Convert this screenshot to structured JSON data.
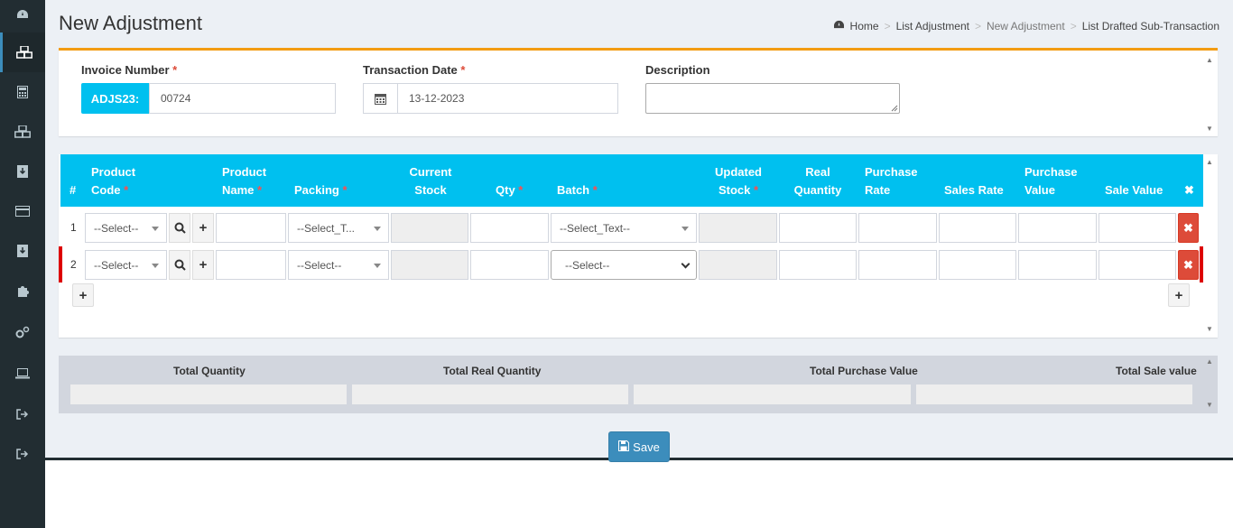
{
  "header": {
    "title": "New Adjustment",
    "breadcrumb": [
      "Home",
      "List Adjustment",
      "New Adjustment",
      "List Drafted Sub-Transaction"
    ],
    "separator": ">"
  },
  "sidebar": {
    "icons": [
      "dashboard-icon",
      "cubes-icon",
      "calculator-icon",
      "cubes-icon",
      "download-icon",
      "credit-card-icon",
      "download-icon",
      "puzzle-icon",
      "gears-icon",
      "laptop-icon",
      "sign-out-icon",
      "sign-out-icon"
    ]
  },
  "form": {
    "invoice_label": "Invoice Number",
    "invoice_prefix": "ADJS23:",
    "invoice_value": "00724",
    "date_label": "Transaction Date",
    "date_value": "13-12-2023",
    "description_label": "Description",
    "required_mark": "*"
  },
  "table": {
    "headers": {
      "num": "#",
      "product_code_1": "Product",
      "product_code_2": "Code",
      "product_name_1": "Product",
      "product_name_2": "Name",
      "packing": "Packing",
      "current_stock_1": "Current",
      "current_stock_2": "Stock",
      "qty": "Qty",
      "batch": "Batch",
      "updated_stock_1": "Updated",
      "updated_stock_2": "Stock",
      "real_quantity_1": "Real",
      "real_quantity_2": "Quantity",
      "purchase_rate_1": "Purchase",
      "purchase_rate_2": "Rate",
      "sales_rate": "Sales Rate",
      "purchase_value_1": "Purchase",
      "purchase_value_2": "Value",
      "sale_value": "Sale Value",
      "remove_all": "✖"
    },
    "rows": [
      {
        "num": "1",
        "product_code": "--Select--",
        "packing": "--Select_T...",
        "batch": "--Select_Text--"
      },
      {
        "num": "2",
        "product_code": "--Select--",
        "packing": "--Select--",
        "batch": "--Select--"
      }
    ]
  },
  "totals": {
    "total_quantity": "Total Quantity",
    "total_real_quantity": "Total Real Quantity",
    "total_purchase_value": "Total Purchase Value",
    "total_sale_value": "Total Sale value"
  },
  "actions": {
    "save_label": "Save"
  },
  "colors": {
    "accent": "#00c0ef",
    "warning_border": "#f39c12",
    "danger": "#dd4b39",
    "primary": "#3c8dbc",
    "sidebar": "#222d32"
  }
}
